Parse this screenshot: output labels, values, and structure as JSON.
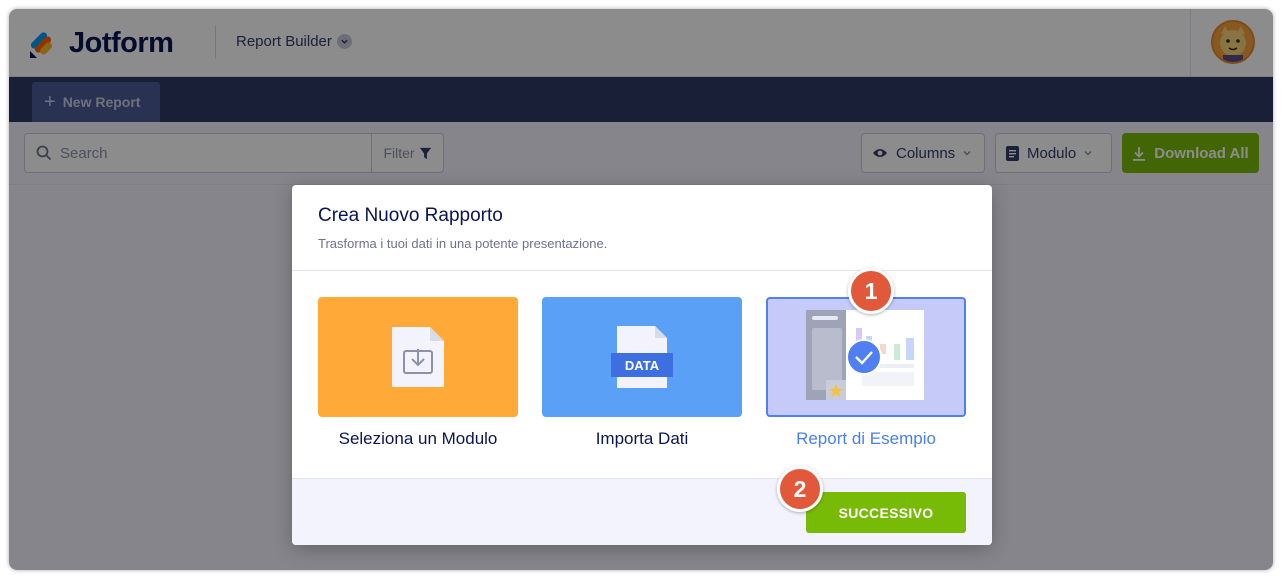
{
  "header": {
    "brand": "Jotform",
    "app_name": "Report Builder"
  },
  "tabs": {
    "new_report": "New Report"
  },
  "toolbar": {
    "search_placeholder": "Search",
    "filter_label": "Filter",
    "columns_label": "Columns",
    "form_label": "Modulo",
    "download_label": "Download All"
  },
  "modal": {
    "title": "Crea Nuovo Rapporto",
    "subtitle": "Trasforma i tuoi dati in una potente presentazione.",
    "options": [
      {
        "label": "Seleziona un Modulo",
        "icon": "form-import-icon",
        "color": "#ffa938"
      },
      {
        "label": "Importa Dati",
        "icon": "data-file-icon",
        "badge_text": "DATA",
        "color": "#5aa0f7"
      },
      {
        "label": "Report di Esempio",
        "icon": "sample-report-icon",
        "selected": true,
        "color": "#c5caf8"
      }
    ],
    "next_label": "SUCCESSIVO"
  },
  "annotations": {
    "step1": "1",
    "step2": "2"
  },
  "colors": {
    "brand_navy": "#0a1551",
    "accent_green": "#78bb07",
    "annotation_red": "#e1593a",
    "selected_blue": "#4f7ff0"
  }
}
